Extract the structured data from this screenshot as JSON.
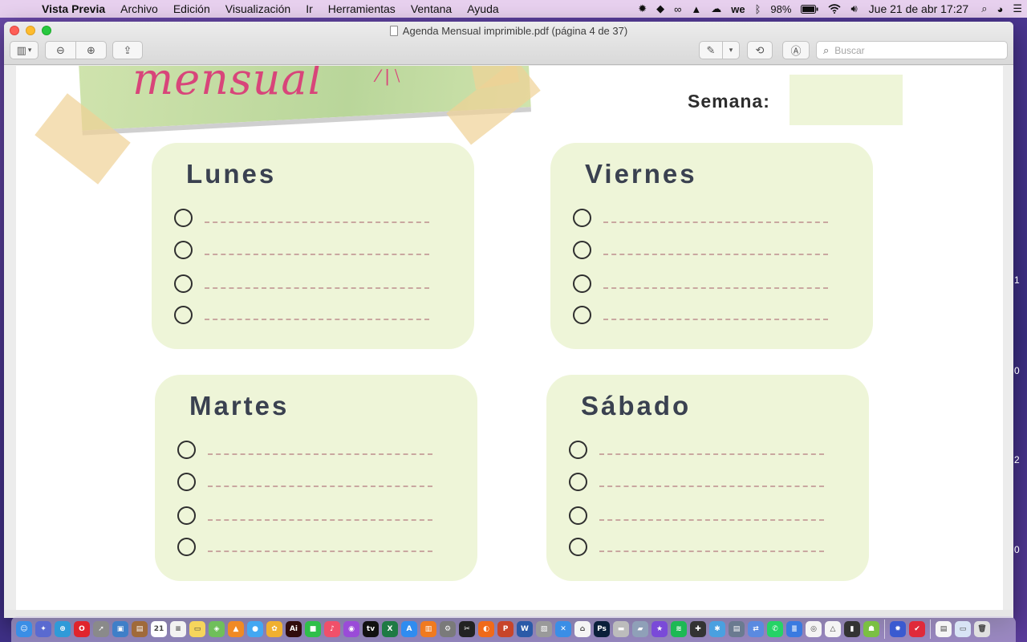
{
  "menubar": {
    "app_name": "Vista Previa",
    "items": [
      "Archivo",
      "Edición",
      "Visualización",
      "Ir",
      "Herramientas",
      "Ventana",
      "Ayuda"
    ],
    "battery": "98%",
    "clock": "Jue 21 de abr  17:27"
  },
  "window": {
    "title": "Agenda Mensual imprimible.pdf (página 4 de 37)",
    "search_placeholder": "Buscar"
  },
  "document": {
    "banner_text": "mensual",
    "semana_label": "Semana:",
    "days": [
      {
        "name": "Lunes"
      },
      {
        "name": "Viernes"
      },
      {
        "name": "Martes"
      },
      {
        "name": "Sábado"
      }
    ],
    "side_numbers": [
      "1",
      "0",
      "2",
      "0"
    ]
  },
  "dock": {
    "apps": [
      {
        "name": "finder-icon",
        "color": "#3a8ee6",
        "glyph": "☺"
      },
      {
        "name": "launchpad-icon",
        "color": "#5a6ad0",
        "glyph": "✦"
      },
      {
        "name": "safari-icon",
        "color": "#2f9ad8",
        "glyph": "⊕"
      },
      {
        "name": "opera-icon",
        "color": "#e0242c",
        "glyph": "O"
      },
      {
        "name": "rocket-icon",
        "color": "#8a8a8a",
        "glyph": "➚"
      },
      {
        "name": "preview-icon",
        "color": "#3f7fc8",
        "glyph": "▣"
      },
      {
        "name": "notes-brown-icon",
        "color": "#a06a3a",
        "glyph": "▤"
      },
      {
        "name": "calendar-icon",
        "color": "#ffffff",
        "glyph": "21"
      },
      {
        "name": "reminders-icon",
        "color": "#f2f2f2",
        "glyph": "≡"
      },
      {
        "name": "notes-icon",
        "color": "#f6d55c",
        "glyph": "▭"
      },
      {
        "name": "maps-icon",
        "color": "#6fbf5a",
        "glyph": "◈"
      },
      {
        "name": "vlc-icon",
        "color": "#f08a24",
        "glyph": "▲"
      },
      {
        "name": "messages-icon",
        "color": "#43a7f2",
        "glyph": "●"
      },
      {
        "name": "photos-icon",
        "color": "#f0b030",
        "glyph": "✿"
      },
      {
        "name": "illustrator-icon",
        "color": "#310c0c",
        "glyph": "Ai"
      },
      {
        "name": "facetime-icon",
        "color": "#2fbf4a",
        "glyph": "■"
      },
      {
        "name": "music-icon",
        "color": "#f0506a",
        "glyph": "♪"
      },
      {
        "name": "podcasts-icon",
        "color": "#9a4bd8",
        "glyph": "◉"
      },
      {
        "name": "tv-icon",
        "color": "#111111",
        "glyph": "tv"
      },
      {
        "name": "excel-icon",
        "color": "#1e7a44",
        "glyph": "X"
      },
      {
        "name": "appstore-icon",
        "color": "#2f8cf0",
        "glyph": "A"
      },
      {
        "name": "books-icon",
        "color": "#f07a20",
        "glyph": "▥"
      },
      {
        "name": "system-prefs-icon",
        "color": "#7a7a7a",
        "glyph": "⚙"
      },
      {
        "name": "finalcut-icon",
        "color": "#222222",
        "glyph": "✂"
      },
      {
        "name": "firefox-icon",
        "color": "#f06a1a",
        "glyph": "◐"
      },
      {
        "name": "powerpoint-icon",
        "color": "#c8452a",
        "glyph": "P"
      },
      {
        "name": "word-icon",
        "color": "#2a5aa8",
        "glyph": "W"
      },
      {
        "name": "scanner-icon",
        "color": "#9a9a9a",
        "glyph": "▧"
      },
      {
        "name": "xcode-icon",
        "color": "#3a8ee6",
        "glyph": "✕"
      },
      {
        "name": "home-icon",
        "color": "#f5f5f5",
        "glyph": "⌂"
      },
      {
        "name": "photoshop-icon",
        "color": "#0a1f3a",
        "glyph": "Ps"
      },
      {
        "name": "printer-icon",
        "color": "#bcbcbc",
        "glyph": "▬"
      },
      {
        "name": "car-icon",
        "color": "#8fa0b8",
        "glyph": "▰"
      },
      {
        "name": "imovie-icon",
        "color": "#7a4ad8",
        "glyph": "★"
      },
      {
        "name": "spotify-icon",
        "color": "#1db954",
        "glyph": "≋"
      },
      {
        "name": "gamepad-icon",
        "color": "#333333",
        "glyph": "✚"
      },
      {
        "name": "puzzle-icon",
        "color": "#4aa0e0",
        "glyph": "✱"
      },
      {
        "name": "disk-icon",
        "color": "#6a7a90",
        "glyph": "▤"
      },
      {
        "name": "migration-icon",
        "color": "#5a8ae0",
        "glyph": "⇄"
      },
      {
        "name": "whatsapp-icon",
        "color": "#25d366",
        "glyph": "✆"
      },
      {
        "name": "docs-icon",
        "color": "#3a7ae0",
        "glyph": "≣"
      },
      {
        "name": "chrome-icon",
        "color": "#f4f4f4",
        "glyph": "◎"
      },
      {
        "name": "drive-icon",
        "color": "#f5f5f5",
        "glyph": "△"
      },
      {
        "name": "usb-icon",
        "color": "#333333",
        "glyph": "▮"
      },
      {
        "name": "android-icon",
        "color": "#7ac043",
        "glyph": "☗"
      },
      {
        "name": "settings-gear-icon",
        "color": "#3a5ad0",
        "glyph": "✹"
      },
      {
        "name": "shield-icon",
        "color": "#e02a3a",
        "glyph": "✔"
      },
      {
        "name": "document-icon",
        "color": "#f5f5f5",
        "glyph": "▤"
      },
      {
        "name": "folder-icon",
        "color": "#d8e4f5",
        "glyph": "▭"
      },
      {
        "name": "trash-icon",
        "color": "#e0e0e0",
        "glyph": "🗑"
      }
    ]
  }
}
